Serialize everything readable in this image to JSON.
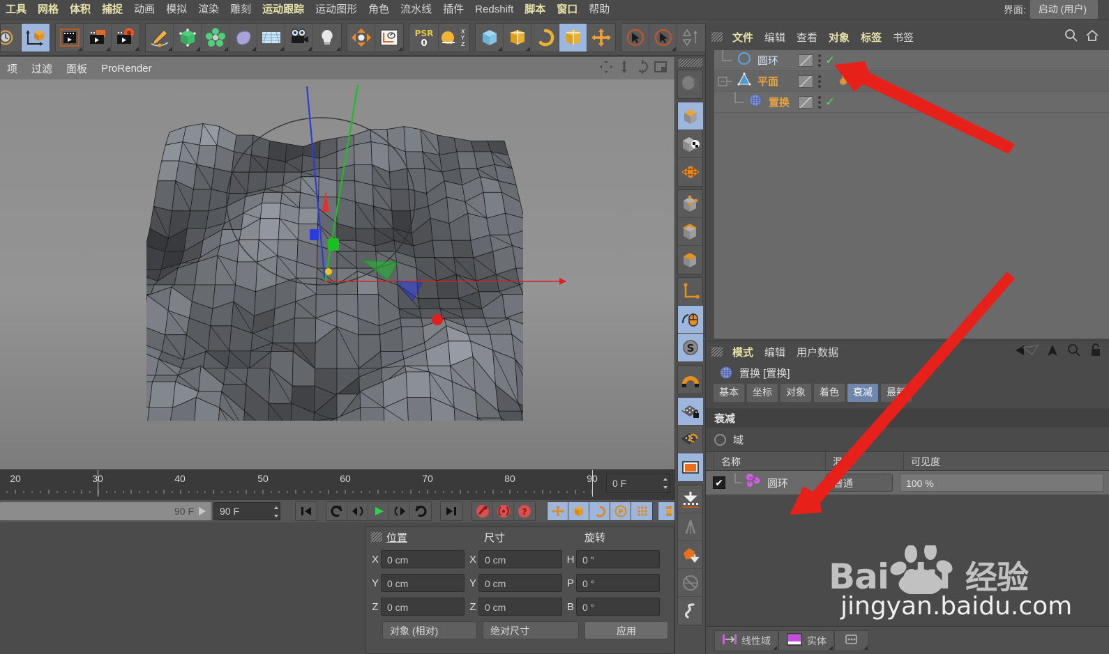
{
  "app": {
    "interface_label": "界面:",
    "interface_value": "启动 (用户)"
  },
  "menubar": {
    "items": [
      {
        "label": "工具",
        "style": "hl"
      },
      {
        "label": "网格",
        "style": "hl"
      },
      {
        "label": "体积",
        "style": "hl"
      },
      {
        "label": "捕捉",
        "style": "hl"
      },
      {
        "label": "动画",
        "style": "plain"
      },
      {
        "label": "模拟",
        "style": "plain"
      },
      {
        "label": "渲染",
        "style": "plain"
      },
      {
        "label": "雕刻",
        "style": "plain"
      },
      {
        "label": "运动跟踪",
        "style": "hl"
      },
      {
        "label": "运动图形",
        "style": "plain"
      },
      {
        "label": "角色",
        "style": "plain"
      },
      {
        "label": "流水线",
        "style": "plain"
      },
      {
        "label": "插件",
        "style": "plain"
      },
      {
        "label": "Redshift",
        "style": "plain"
      },
      {
        "label": "脚本",
        "style": "hl"
      },
      {
        "label": "窗口",
        "style": "hl"
      },
      {
        "label": "帮助",
        "style": "plain"
      }
    ]
  },
  "toolbar": {
    "groups": [
      {
        "buttons": [
          {
            "name": "undo-redo-icon",
            "icon": "clock",
            "selected": false
          },
          {
            "name": "world-object-axis-icon",
            "icon": "axis-cube",
            "selected": true
          }
        ]
      },
      {
        "buttons": [
          {
            "name": "render-view-icon",
            "icon": "clapper-frame",
            "selected": false
          },
          {
            "name": "render-to-picture-viewer-icon",
            "icon": "clapper-box",
            "selected": false
          },
          {
            "name": "render-settings-icon",
            "icon": "clapper-gear",
            "selected": false
          }
        ]
      },
      {
        "buttons": [
          {
            "name": "spline-pen-icon",
            "icon": "pen",
            "selected": false
          },
          {
            "name": "cube-primitive-icon",
            "icon": "green-cube",
            "selected": false
          },
          {
            "name": "array-generator-icon",
            "icon": "green-cluster",
            "selected": false
          },
          {
            "name": "bend-deformer-icon",
            "icon": "purple-blob",
            "selected": false
          },
          {
            "name": "floor-environment-icon",
            "icon": "sky-grid",
            "selected": false
          },
          {
            "name": "camera-icon",
            "icon": "camera",
            "selected": false
          },
          {
            "name": "light-icon",
            "icon": "bulb",
            "selected": false
          }
        ]
      },
      {
        "buttons": [
          {
            "name": "deformer-icon",
            "icon": "arrows-in",
            "selected": false
          },
          {
            "name": "spline-tools-icon",
            "icon": "spline-panel",
            "selected": false
          }
        ]
      },
      {
        "buttons": [
          {
            "name": "psr-transform-icon",
            "icon": "psr",
            "selected": false
          },
          {
            "name": "coordinate-xyz-icon",
            "icon": "xyz-ball",
            "selected": false
          }
        ]
      },
      {
        "buttons": [
          {
            "name": "model-mode-icon",
            "icon": "blue-cube",
            "selected": false
          },
          {
            "name": "object-mode-icon",
            "icon": "yellow-cube",
            "selected": false
          },
          {
            "name": "texture-mode-icon",
            "icon": "yellow-ring",
            "selected": false
          },
          {
            "name": "polygon-mode-icon",
            "icon": "yellow-cube2",
            "selected": true
          },
          {
            "name": "move-tool-icon",
            "icon": "move-cross",
            "selected": false
          }
        ]
      },
      {
        "buttons": [
          {
            "name": "select-visible-only-icon",
            "icon": "cursor-ring",
            "selected": false
          },
          {
            "name": "select-tool-icon",
            "icon": "cursor-ring2",
            "selected": false
          },
          {
            "name": "snap-settings-icon",
            "icon": "snap-tri",
            "selected": false
          }
        ]
      }
    ]
  },
  "viewport": {
    "menu": [
      "项",
      "过滤",
      "面板",
      "ProRender"
    ],
    "corner_icons": [
      "pan-icon",
      "zoom-icon",
      "rotate-icon",
      "layout-icon"
    ]
  },
  "timeline": {
    "ticks": [
      "20",
      "30",
      "40",
      "50",
      "60",
      "70",
      "80",
      "90"
    ],
    "current_frame": "0 F",
    "range_end_label": "90 F",
    "end_frame_value": "90 F",
    "transport_buttons": [
      {
        "name": "go-to-start-button",
        "icon": "skip-start"
      },
      {
        "name": "play-backwards-loop-button",
        "icon": "loop-ccw"
      },
      {
        "name": "previous-key-button",
        "icon": "prev-key"
      },
      {
        "name": "play-button",
        "icon": "play"
      },
      {
        "name": "next-key-button",
        "icon": "next-key"
      },
      {
        "name": "loop-button",
        "icon": "loop-cw"
      },
      {
        "name": "go-to-end-button",
        "icon": "skip-end"
      },
      {
        "name": "record-active-objects-button",
        "icon": "rec-red"
      },
      {
        "name": "autokeying-button",
        "icon": "autokey-red"
      },
      {
        "name": "keyframe-selection-button",
        "icon": "question-red"
      },
      {
        "name": "record-position-button",
        "icon": "pos-cross"
      },
      {
        "name": "record-scale-button",
        "icon": "scale-cube"
      },
      {
        "name": "record-rotation-button",
        "icon": "rot-ring"
      },
      {
        "name": "record-param-button",
        "icon": "param-p"
      },
      {
        "name": "record-pla-button",
        "icon": "pla-dots"
      },
      {
        "name": "keyframe-mode-button",
        "icon": "key-stack"
      }
    ]
  },
  "coordinates": {
    "headers": [
      "位置",
      "尺寸",
      "旋转"
    ],
    "rows": [
      {
        "axis1": "X",
        "pos": "0 cm",
        "axis2": "X",
        "size": "0 cm",
        "axis3": "H",
        "rot": "0 °"
      },
      {
        "axis1": "Y",
        "pos": "0 cm",
        "axis2": "Y",
        "size": "0 cm",
        "axis3": "P",
        "rot": "0 °"
      },
      {
        "axis1": "Z",
        "pos": "0 cm",
        "axis2": "Z",
        "size": "0 cm",
        "axis3": "B",
        "rot": "0 °"
      }
    ],
    "mode_dropdown": "对象 (相对)",
    "size_dropdown": "绝对尺寸",
    "apply_button": "应用"
  },
  "right_toolbar": {
    "buttons": [
      {
        "name": "sculpt-icon",
        "icon": "skull",
        "selected": false
      },
      {
        "name": "model-mode-vicon",
        "icon": "cube-orange",
        "selected": true
      },
      {
        "name": "texture-mode-vicon",
        "icon": "cube-checker",
        "selected": false
      },
      {
        "name": "workplane-mode-vicon",
        "icon": "orange-grid",
        "selected": false
      },
      {
        "name": "point-mode-vicon",
        "icon": "cube-points",
        "selected": false
      },
      {
        "name": "edge-mode-vicon",
        "icon": "cube-edges",
        "selected": false
      },
      {
        "name": "polygon-mode-vicon",
        "icon": "cube-poly",
        "selected": false
      },
      {
        "name": "axis-mode-vicon",
        "icon": "axis-orange",
        "selected": false
      },
      {
        "name": "viewport-solo-vicon",
        "icon": "mouse-orange",
        "selected": true
      },
      {
        "name": "snap-enable-vicon",
        "icon": "s-circle",
        "selected": true
      },
      {
        "name": "magnet-tool-vicon",
        "icon": "magnet",
        "selected": false
      },
      {
        "name": "lock-workplane-vicon",
        "icon": "grid-lock",
        "selected": true
      },
      {
        "name": "workplane-tool-vicon",
        "icon": "grid-tool",
        "selected": false
      },
      {
        "name": "layer-color-vicon",
        "icon": "orange-folder",
        "selected": true
      },
      {
        "name": "fallback-vicon",
        "icon": "down-arrow",
        "selected": false
      },
      {
        "name": "symmetry-vicon",
        "icon": "symmetry",
        "selected": false
      },
      {
        "name": "collapse-vicon",
        "icon": "orange-poly-down",
        "selected": false
      },
      {
        "name": "disabled-vicon",
        "icon": "circle-slash",
        "selected": false
      },
      {
        "name": "python-vicon",
        "icon": "python",
        "selected": false
      }
    ]
  },
  "object_manager": {
    "menu": [
      {
        "label": "文件",
        "style": "y"
      },
      {
        "label": "编辑",
        "style": "w"
      },
      {
        "label": "查看",
        "style": "w"
      },
      {
        "label": "对象",
        "style": "y"
      },
      {
        "label": "标签",
        "style": "y"
      },
      {
        "label": "书签",
        "style": "w"
      }
    ],
    "search_icon": "search-icon",
    "home_icon": "home-icon",
    "rows": [
      {
        "name": "圆环",
        "color": "blue",
        "icon": "circle-spline-icon",
        "indent": 10,
        "check": true,
        "tags": []
      },
      {
        "name": "平面",
        "color": "orange",
        "icon": "plane-object-icon",
        "indent": 10,
        "check": false,
        "tags": [
          "texture-tag",
          "texture-tag2",
          "display-tag"
        ]
      },
      {
        "name": "置换",
        "color": "orange",
        "icon": "displacer-icon",
        "indent": 34,
        "check": true,
        "tags": []
      }
    ]
  },
  "attributes": {
    "menu": [
      {
        "label": "模式",
        "style": "y"
      },
      {
        "label": "编辑",
        "style": "w"
      },
      {
        "label": "用户数据",
        "style": "w"
      }
    ],
    "header_icons": [
      "back-nav-icon",
      "up-nav-icon",
      "search-icon",
      "lock-icon"
    ],
    "object_title": "置换 [置换]",
    "object_icon": "displacer-icon",
    "tabs": [
      {
        "label": "基本",
        "active": false
      },
      {
        "label": "坐标",
        "active": false
      },
      {
        "label": "对象",
        "active": false
      },
      {
        "label": "着色",
        "active": false
      },
      {
        "label": "衰减",
        "active": true
      },
      {
        "label": "最新",
        "active": false
      }
    ],
    "section_title": "衰减",
    "field_row_label": "域",
    "list_headers": [
      "名称",
      "混合",
      "可见度"
    ],
    "list_rows": [
      {
        "checked": "✔",
        "icon": "field-object-icon",
        "name": "圆环",
        "blend": "普通",
        "visibility": "100 %"
      }
    ],
    "bottom_buttons": [
      {
        "label": "线性域",
        "icon": "linear-field-icon"
      },
      {
        "label": "实体",
        "icon": "solid-field-icon"
      },
      {
        "label": "",
        "icon": "more-fields-icon"
      }
    ]
  },
  "watermark": {
    "logo": "Baidu经验",
    "url": "jingyan.baidu.com"
  },
  "colors": {
    "accent_orange": "#e8a33d",
    "selection_blue": "#9db6dd",
    "menu_yellow": "#e8e2a8",
    "check_green": "#5fd45f",
    "arrow_red": "#e8201a",
    "panel_bg": "#4a4a4a",
    "list_bg": "#6a6a6a"
  }
}
